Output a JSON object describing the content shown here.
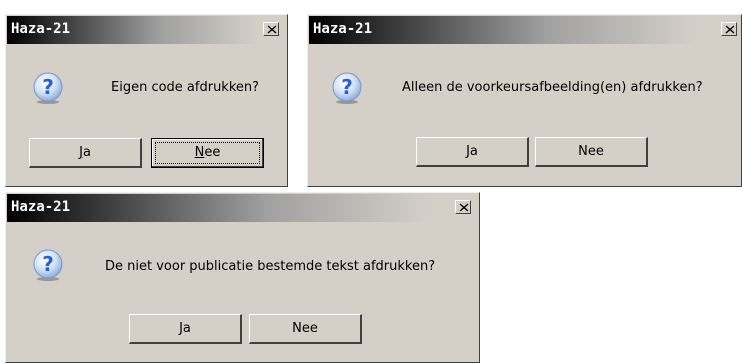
{
  "dialogs": [
    {
      "title": "Haza-21",
      "message": "Eigen code afdrukken?",
      "buttons": [
        {
          "label_pre": "",
          "label_ul": "J",
          "label_post": "a"
        },
        {
          "label_pre": "",
          "label_ul": "N",
          "label_post": "ee"
        }
      ]
    },
    {
      "title": "Haza-21",
      "message": "Alleen de voorkeursafbeelding(en) afdrukken?",
      "buttons": [
        {
          "label": "Ja"
        },
        {
          "label": "Nee"
        }
      ]
    },
    {
      "title": "Haza-21",
      "message": "De niet voor publicatie bestemde tekst afdrukken?",
      "buttons": [
        {
          "label": "Ja"
        },
        {
          "label": "Nee"
        }
      ]
    }
  ],
  "icons": {
    "question": "question-icon",
    "close": "close-icon"
  },
  "colors": {
    "dialog_bg": "#d4d0c8",
    "icon_blue": "#2a5fd0"
  }
}
